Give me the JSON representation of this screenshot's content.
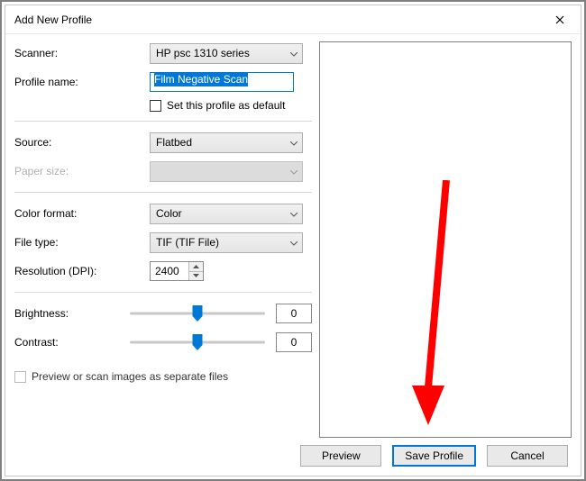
{
  "window": {
    "title": "Add New Profile"
  },
  "labels": {
    "scanner": "Scanner:",
    "profile_name": "Profile name:",
    "set_default": "Set this profile as default",
    "source": "Source:",
    "paper_size": "Paper size:",
    "color_format": "Color format:",
    "file_type": "File type:",
    "resolution": "Resolution (DPI):",
    "brightness": "Brightness:",
    "contrast": "Contrast:",
    "separate_files": "Preview or scan images as separate files"
  },
  "values": {
    "scanner": "HP psc 1310 series",
    "profile_name": "Film Negative Scan",
    "source": "Flatbed",
    "paper_size": "",
    "color_format": "Color",
    "file_type": "TIF (TIF File)",
    "resolution": "2400",
    "brightness": "0",
    "contrast": "0",
    "set_default_checked": false,
    "separate_files_checked": false
  },
  "buttons": {
    "preview": "Preview",
    "save": "Save Profile",
    "cancel": "Cancel"
  }
}
